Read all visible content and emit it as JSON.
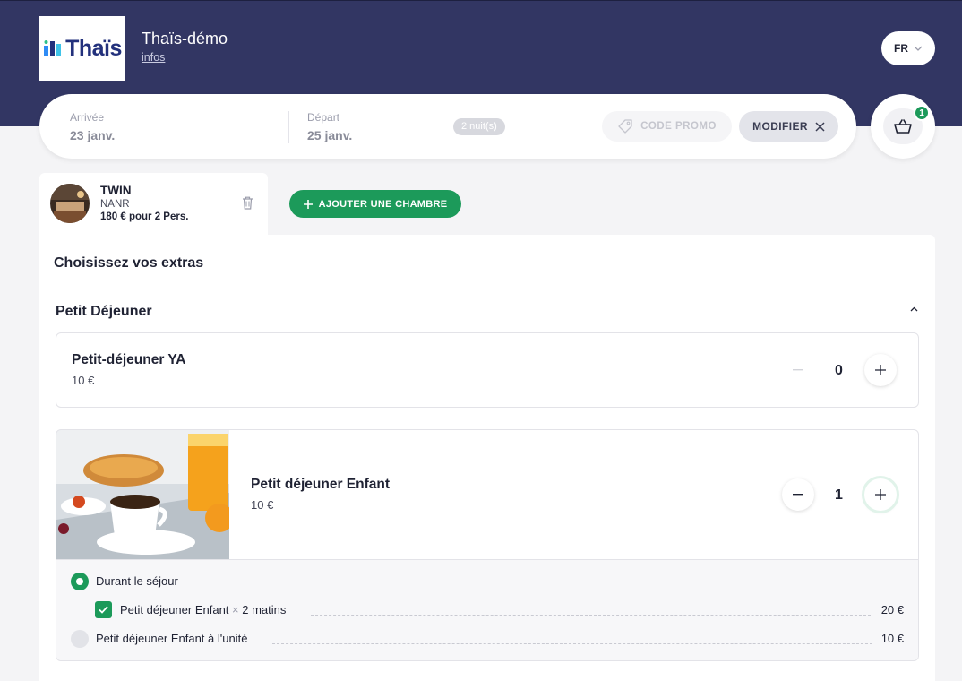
{
  "header": {
    "logo_text": "Thaïs",
    "hotel_name": "Thaïs-démo",
    "infos_link": "infos",
    "language": "FR"
  },
  "search": {
    "arrival_label": "Arrivée",
    "arrival_value": "23 janv.",
    "departure_label": "Départ",
    "departure_value": "25 janv.",
    "nights": "2 nuit(s)",
    "promo_label": "CODE PROMO",
    "modify_label": "MODIFIER"
  },
  "cart": {
    "count": "1"
  },
  "room": {
    "name": "TWIN",
    "rate": "NANR",
    "price": "180 € pour 2 Pers.",
    "add_room_label": "AJOUTER UNE CHAMBRE"
  },
  "extras": {
    "title": "Choisissez vos extras",
    "section": "Petit Déjeuner",
    "items": [
      {
        "name": "Petit-déjeuner YA",
        "price": "10 €",
        "quantity": "0"
      },
      {
        "name": "Petit déjeuner Enfant",
        "price": "10 €",
        "quantity": "1"
      }
    ],
    "options": {
      "during_stay_label": "Durant le séjour",
      "line1_name": "Petit déjeuner Enfant",
      "line1_times": "×",
      "line1_qty": "2 matins",
      "line1_price": "20 €",
      "unit_label": "Petit déjeuner Enfant à l'unité",
      "unit_price": "10 €"
    }
  },
  "colors": {
    "header_bg": "#323663",
    "accent_green": "#1c9a5a",
    "brand_blue": "#23317c"
  }
}
